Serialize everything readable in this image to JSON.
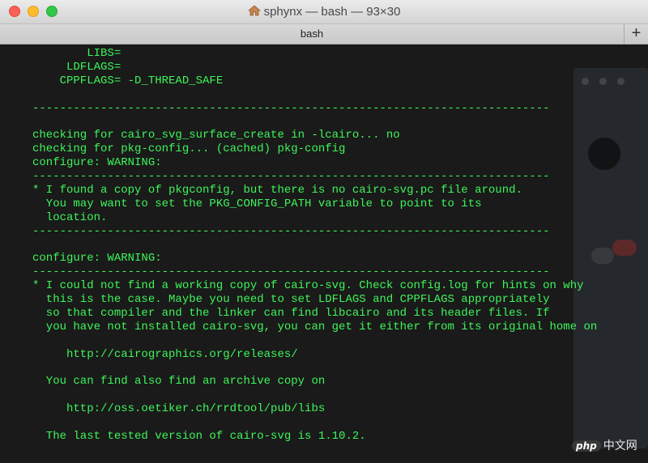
{
  "window": {
    "title": "sphynx — bash — 93×30",
    "tab_label": "bash",
    "new_tab_label": "+"
  },
  "terminal": {
    "lines": [
      "        LIBS=",
      "     LDFLAGS=",
      "    CPPFLAGS= -D_THREAD_SAFE",
      "",
      "----------------------------------------------------------------------------",
      "",
      "checking for cairo_svg_surface_create in -lcairo... no",
      "checking for pkg-config... (cached) pkg-config",
      "configure: WARNING:",
      "----------------------------------------------------------------------------",
      "* I found a copy of pkgconfig, but there is no cairo-svg.pc file around.",
      "  You may want to set the PKG_CONFIG_PATH variable to point to its",
      "  location.",
      "----------------------------------------------------------------------------",
      "",
      "configure: WARNING:",
      "----------------------------------------------------------------------------",
      "* I could not find a working copy of cairo-svg. Check config.log for hints on why",
      "  this is the case. Maybe you need to set LDFLAGS and CPPFLAGS appropriately",
      "  so that compiler and the linker can find libcairo and its header files. If",
      "  you have not installed cairo-svg, you can get it either from its original home on",
      "",
      "     http://cairographics.org/releases/",
      "",
      "  You can find also find an archive copy on",
      "",
      "     http://oss.oetiker.ch/rrdtool/pub/libs",
      "",
      "  The last tested version of cairo-svg is 1.10.2.",
      ""
    ]
  },
  "watermark": {
    "logo_text": "php",
    "site_text": "中文网"
  },
  "colors": {
    "terminal_text": "#3ef55a",
    "terminal_bg": "#1a1a1a"
  }
}
